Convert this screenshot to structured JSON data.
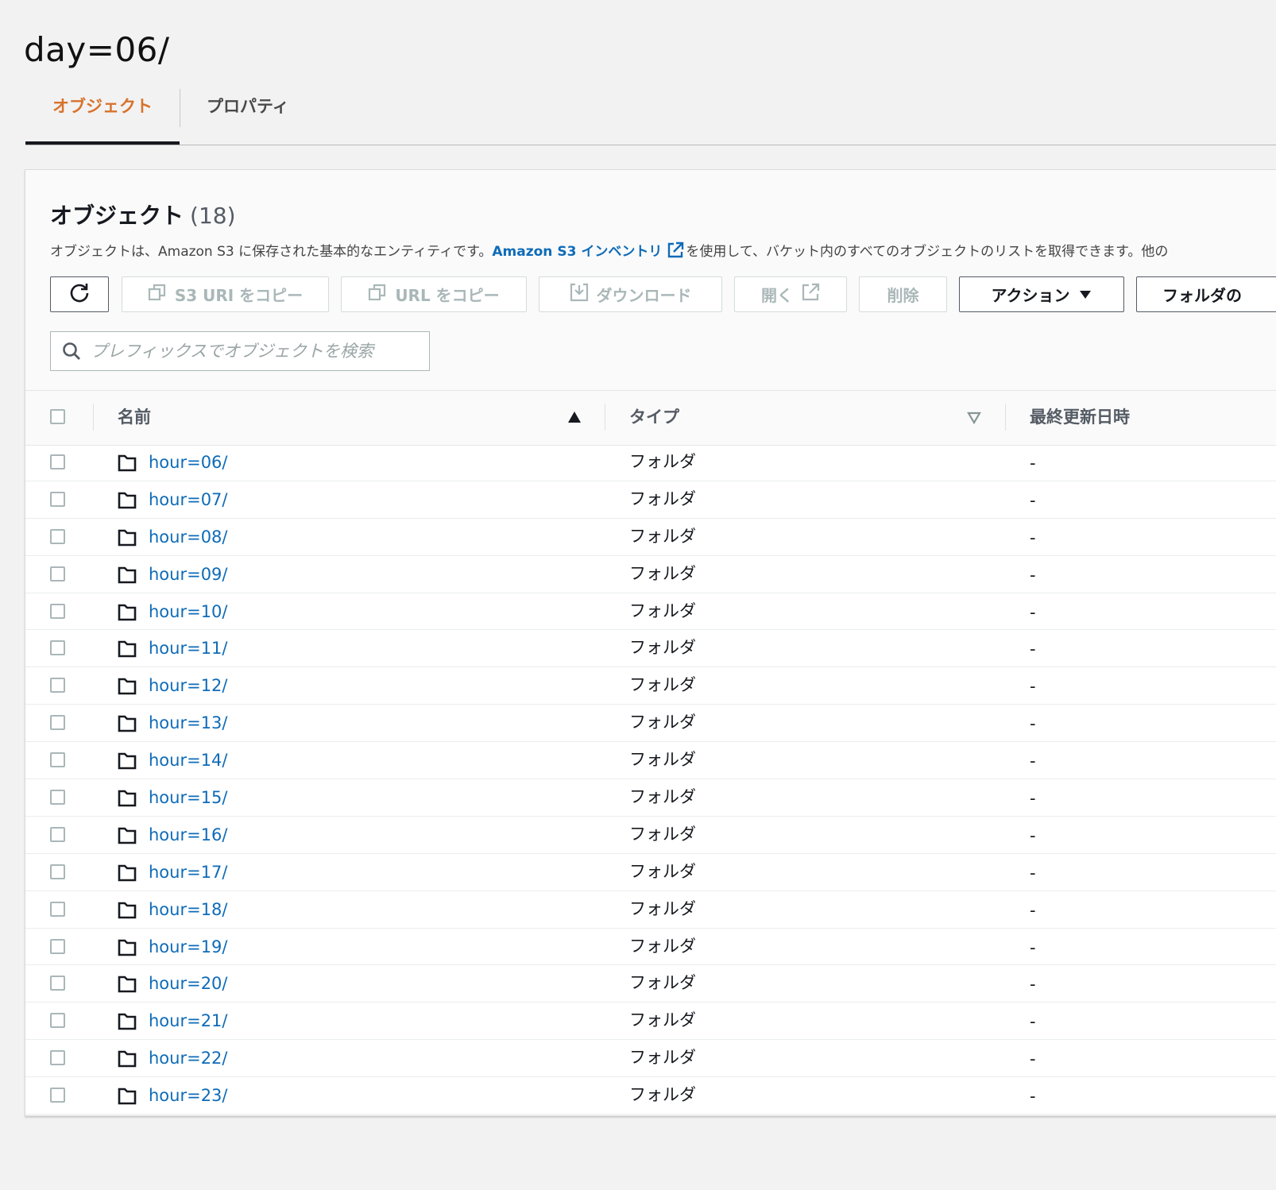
{
  "page": {
    "title": "day=06/"
  },
  "tabs": [
    {
      "label": "オブジェクト",
      "active": true
    },
    {
      "label": "プロパティ",
      "active": false
    }
  ],
  "objects_panel": {
    "title": "オブジェクト",
    "count": "(18)",
    "description_before": "オブジェクトは、Amazon S3 に保存された基本的なエンティティです。",
    "description_link": "Amazon S3 インベントリ",
    "description_after": "を使用して、バケット内のすべてのオブジェクトのリストを取得できます。他の"
  },
  "toolbar": {
    "refresh_icon": "refresh-icon",
    "copy_s3_uri": "S3 URI をコピー",
    "copy_url": "URL をコピー",
    "download": "ダウンロード",
    "open": "開く",
    "delete": "削除",
    "actions": "アクション",
    "create_folder": "フォルダの"
  },
  "search": {
    "placeholder": "プレフィックスでオブジェクトを検索",
    "value": ""
  },
  "table": {
    "columns": {
      "name": "名前",
      "type": "タイプ",
      "last_modified": "最終更新日時"
    },
    "sort": {
      "column": "name",
      "direction": "ascending"
    },
    "rows": [
      {
        "name": "hour=06/",
        "type": "フォルダ",
        "last_modified": "-"
      },
      {
        "name": "hour=07/",
        "type": "フォルダ",
        "last_modified": "-"
      },
      {
        "name": "hour=08/",
        "type": "フォルダ",
        "last_modified": "-"
      },
      {
        "name": "hour=09/",
        "type": "フォルダ",
        "last_modified": "-"
      },
      {
        "name": "hour=10/",
        "type": "フォルダ",
        "last_modified": "-"
      },
      {
        "name": "hour=11/",
        "type": "フォルダ",
        "last_modified": "-"
      },
      {
        "name": "hour=12/",
        "type": "フォルダ",
        "last_modified": "-"
      },
      {
        "name": "hour=13/",
        "type": "フォルダ",
        "last_modified": "-"
      },
      {
        "name": "hour=14/",
        "type": "フォルダ",
        "last_modified": "-"
      },
      {
        "name": "hour=15/",
        "type": "フォルダ",
        "last_modified": "-"
      },
      {
        "name": "hour=16/",
        "type": "フォルダ",
        "last_modified": "-"
      },
      {
        "name": "hour=17/",
        "type": "フォルダ",
        "last_modified": "-"
      },
      {
        "name": "hour=18/",
        "type": "フォルダ",
        "last_modified": "-"
      },
      {
        "name": "hour=19/",
        "type": "フォルダ",
        "last_modified": "-"
      },
      {
        "name": "hour=20/",
        "type": "フォルダ",
        "last_modified": "-"
      },
      {
        "name": "hour=21/",
        "type": "フォルダ",
        "last_modified": "-"
      },
      {
        "name": "hour=22/",
        "type": "フォルダ",
        "last_modified": "-"
      },
      {
        "name": "hour=23/",
        "type": "フォルダ",
        "last_modified": "-"
      }
    ]
  },
  "colors": {
    "link": "#0e6bb8",
    "active_tab": "#d8722c",
    "disabled_text": "#aab7b8"
  }
}
